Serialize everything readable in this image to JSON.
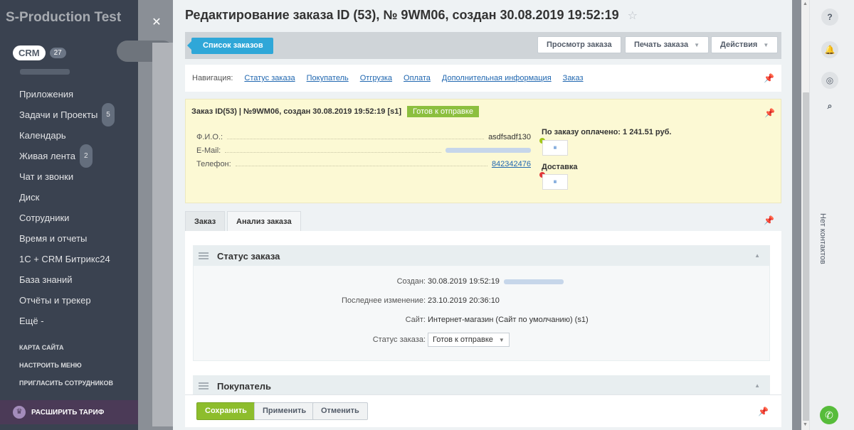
{
  "background": {
    "portal_name": "S-Production Test",
    "crm_label": "CRM",
    "crm_count": "27",
    "menu": [
      {
        "label": "Приложения",
        "count": ""
      },
      {
        "label": "Задачи и Проекты",
        "count": "5"
      },
      {
        "label": "Календарь",
        "count": ""
      },
      {
        "label": "Живая лента",
        "count": "2"
      },
      {
        "label": "Чат и звонки",
        "count": ""
      },
      {
        "label": "Диск",
        "count": ""
      },
      {
        "label": "Сотрудники",
        "count": ""
      },
      {
        "label": "Время и отчеты",
        "count": ""
      },
      {
        "label": "1С + CRM Битрикс24",
        "count": ""
      },
      {
        "label": "База знаний",
        "count": ""
      },
      {
        "label": "Отчёты и трекер",
        "count": ""
      },
      {
        "label": "Ещё -",
        "count": ""
      }
    ],
    "small_links": [
      "КАРТА САЙТА",
      "НАСТРОИТЬ МЕНЮ",
      "ПРИГЛАСИТЬ СОТРУДНИКОВ"
    ],
    "upgrade": "РАСШИРИТЬ ТАРИФ"
  },
  "panel": {
    "title": "Редактирование заказа ID (53), № 9WM06, создан 30.08.2019 19:52:19",
    "toolbar": {
      "list_button": "Список заказов",
      "view_button": "Просмотр заказа",
      "print_button": "Печать заказа",
      "actions_button": "Действия"
    },
    "navigation": {
      "label": "Навигация:",
      "links": [
        "Статус заказа",
        "Покупатель",
        "Отгрузка",
        "Оплата",
        "Дополнительная информация",
        "Заказ"
      ]
    },
    "summary": {
      "header": "Заказ ID(53) | №9WM06, создан 30.08.2019 19:52:19 [s1]",
      "status": "Готов к отправке",
      "fio_label": "Ф.И.О.:",
      "fio_value": "asdfsadf130",
      "email_label": "E-Mail:",
      "phone_label": "Телефон:",
      "phone_value": "842342476",
      "paid_text": "По заказу оплачено: 1 241.51 руб.",
      "delivery_title": "Доставка"
    },
    "tabs": [
      "Заказ",
      "Анализ заказа"
    ],
    "status_section": {
      "title": "Статус заказа",
      "created_label": "Создан:",
      "created_value": "30.08.2019 19:52:19",
      "modified_label": "Последнее изменение:",
      "modified_value": "23.10.2019 20:36:10",
      "site_label": "Сайт:",
      "site_value": "Интернет-магазин (Сайт по умолчанию) (s1)",
      "order_status_label": "Статус заказа:",
      "order_status_value": "Готов к отправке"
    },
    "buyer_section": {
      "title": "Покупатель"
    },
    "footer": {
      "save": "Сохранить",
      "apply": "Применить",
      "cancel": "Отменить"
    }
  },
  "rail": {
    "no_contacts": "Нет контактов"
  },
  "colors": {
    "accent": "#2fa7d8",
    "save": "#8dbd2c",
    "status": "#8cbf3f",
    "summary_bg": "#fcf9d4"
  }
}
